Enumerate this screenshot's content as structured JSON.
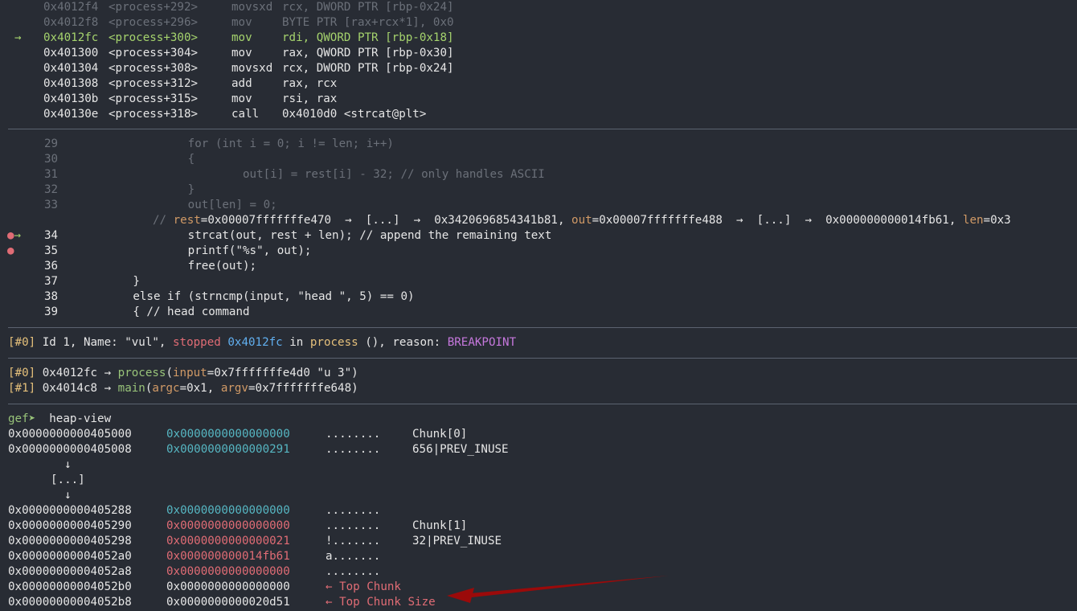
{
  "disasm": [
    {
      "marker": "",
      "addr": "0x4012f4",
      "sym": "<process+292>",
      "mn": "movsxd",
      "ops": "rcx, DWORD PTR [rbp-0x24]",
      "state": "past"
    },
    {
      "marker": "",
      "addr": "0x4012f8",
      "sym": "<process+296>",
      "mn": "mov",
      "ops": "BYTE PTR [rax+rcx*1], 0x0",
      "state": "past"
    },
    {
      "marker": "→",
      "addr": "0x4012fc",
      "sym": "<process+300>",
      "mn": "mov",
      "ops": "rdi, QWORD PTR [rbp-0x18]",
      "state": "current"
    },
    {
      "marker": "",
      "addr": "0x401300",
      "sym": "<process+304>",
      "mn": "mov",
      "ops": "rax, QWORD PTR [rbp-0x30]",
      "state": "next"
    },
    {
      "marker": "",
      "addr": "0x401304",
      "sym": "<process+308>",
      "mn": "movsxd",
      "ops": "rcx, DWORD PTR [rbp-0x24]",
      "state": "next"
    },
    {
      "marker": "",
      "addr": "0x401308",
      "sym": "<process+312>",
      "mn": "add",
      "ops": "rax, rcx",
      "state": "next"
    },
    {
      "marker": "",
      "addr": "0x40130b",
      "sym": "<process+315>",
      "mn": "mov",
      "ops": "rsi, rax",
      "state": "next"
    },
    {
      "marker": "",
      "addr": "0x40130e",
      "sym": "<process+318>",
      "mn": "call",
      "ops": "0x4010d0 <strcat@plt>",
      "state": "next"
    }
  ],
  "source": [
    {
      "marker": "",
      "num": "29",
      "code": "                for (int i = 0; i != len; i++)",
      "state": "past"
    },
    {
      "marker": "",
      "num": "30",
      "code": "                {",
      "state": "past"
    },
    {
      "marker": "",
      "num": "31",
      "code": "                        out[i] = rest[i] - 32; // only handles ASCII",
      "state": "past"
    },
    {
      "marker": "",
      "num": "32",
      "code": "                }",
      "state": "past"
    },
    {
      "marker": "",
      "num": "33",
      "code": "                out[len] = 0;",
      "state": "past"
    },
    {
      "marker": "●→",
      "num": "34",
      "code": "                strcat(out, rest + len); // append the remaining text",
      "state": "current"
    },
    {
      "marker": "●",
      "num": "35",
      "code": "                printf(\"%s\", out);",
      "state": "next"
    },
    {
      "marker": "",
      "num": "36",
      "code": "                free(out);",
      "state": "next"
    },
    {
      "marker": "",
      "num": "37",
      "code": "        }",
      "state": "next"
    },
    {
      "marker": "",
      "num": "38",
      "code": "        else if (strncmp(input, \"head \", 5) == 0)",
      "state": "next"
    },
    {
      "marker": "",
      "num": "39",
      "code": "        { // head command",
      "state": "next"
    }
  ],
  "hint": {
    "prefix": "// ",
    "rest_name": "rest",
    "rest_val": "=0x00007fffffffe470  →  [...]  →  0x3420696854341b81, ",
    "out_name": "out",
    "out_val": "=0x00007fffffffe488  →  [...]  →  0x000000000014fb61, ",
    "len_name": "len",
    "len_val": "=0x3"
  },
  "thread": {
    "idx": "[#0]",
    "t1": " Id 1, Name: \"vul\", ",
    "stopped": "stopped",
    "t2": " ",
    "addr": "0x4012fc",
    "t3": " in ",
    "func": "process",
    "t4": " (), reason: ",
    "reason": "BREAKPOINT"
  },
  "trace": [
    {
      "idx": "[#0]",
      "addr": " 0x4012fc → ",
      "func": "process",
      "open": "(",
      "a1n": "input",
      "a1v": "=0x7fffffffe4d0 \"u 3\")",
      "a2n": "",
      "a2v": ""
    },
    {
      "idx": "[#1]",
      "addr": " 0x4014c8 → ",
      "func": "main",
      "open": "(",
      "a1n": "argc",
      "a1v": "=0x1, ",
      "a2n": "argv",
      "a2v": "=0x7fffffffe648)"
    }
  ],
  "prompt": {
    "label": "gef➤",
    "cmd": "  heap-view"
  },
  "heap": [
    {
      "addr": "0x0000000000405000",
      "val": "0x0000000000000000",
      "vc": "cyan",
      "ascii": "........",
      "note": "Chunk[0]",
      "nc": "white"
    },
    {
      "addr": "0x0000000000405008",
      "val": "0x0000000000000291",
      "vc": "cyan",
      "ascii": "........",
      "note": "656|PREV_INUSE",
      "nc": "white"
    },
    {
      "addr": "0x0000000000405288",
      "val": "0x0000000000000000",
      "vc": "cyan",
      "ascii": "........",
      "note": "",
      "nc": "white"
    },
    {
      "addr": "0x0000000000405290",
      "val": "0x0000000000000000",
      "vc": "red",
      "ascii": "........",
      "note": "Chunk[1]",
      "nc": "white"
    },
    {
      "addr": "0x0000000000405298",
      "val": "0x0000000000000021",
      "vc": "red",
      "ascii": "!.......",
      "note": "32|PREV_INUSE",
      "nc": "white"
    },
    {
      "addr": "0x00000000004052a0",
      "val": "0x000000000014fb61",
      "vc": "red",
      "ascii": "a.......",
      "note": "",
      "nc": "white"
    },
    {
      "addr": "0x00000000004052a8",
      "val": "0x0000000000000000",
      "vc": "red",
      "ascii": "........",
      "note": "",
      "nc": "white"
    },
    {
      "addr": "0x00000000004052b0",
      "val": "0x0000000000000000",
      "vc": "white",
      "ascii": "← Top Chunk",
      "note": "",
      "nc": "red"
    },
    {
      "addr": "0x00000000004052b8",
      "val": "0x0000000000020d51",
      "vc": "white",
      "ascii": "← Top Chunk Size",
      "note": "",
      "nc": "red"
    }
  ],
  "ellipsis": {
    "down1": "↓",
    "dots": "[...]",
    "down2": "↓"
  },
  "colors": {
    "bg": "#282c34",
    "separator": "#5c6370",
    "annotation_arrow": "#9b0a0a"
  }
}
